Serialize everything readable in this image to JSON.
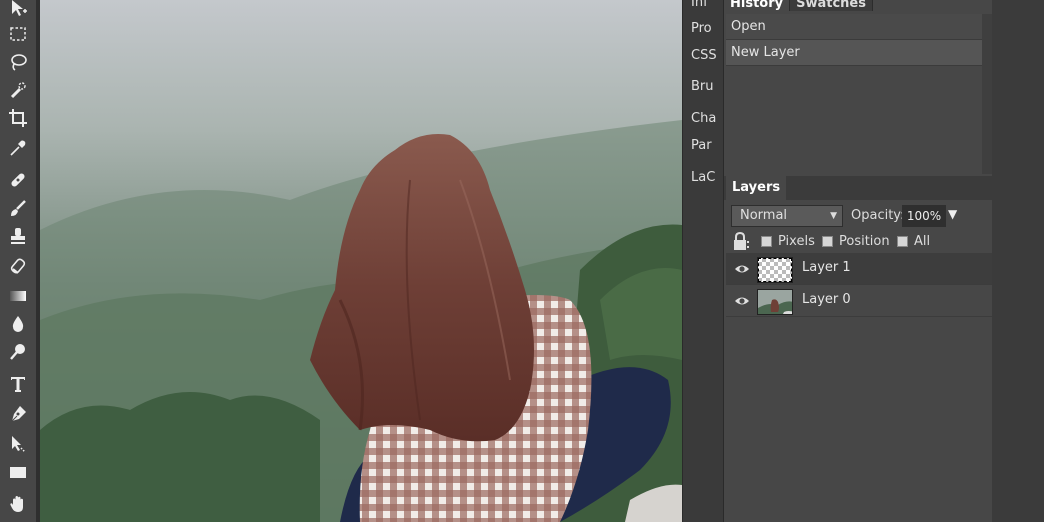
{
  "tools": [
    "move-tool-icon",
    "marquee-tool-icon",
    "lasso-tool-icon",
    "quick-select-tool-icon",
    "crop-tool-icon",
    "eyedropper-tool-icon",
    "healing-tool-icon",
    "brush-tool-icon",
    "clone-stamp-tool-icon",
    "eraser-tool-icon",
    "gradient-tool-icon",
    "blur-tool-icon",
    "dodge-tool-icon",
    "type-tool-icon",
    "pen-tool-icon",
    "path-select-tool-icon",
    "shape-tool-icon",
    "hand-tool-icon"
  ],
  "panel_tabs": [
    "Inf",
    "Pro",
    "CSS",
    "Bru",
    "Cha",
    "Par",
    "LaC"
  ],
  "history": {
    "tabs": [
      "History",
      "Swatches"
    ],
    "items": [
      "Open",
      "New Layer"
    ]
  },
  "layers": {
    "tab": "Layers",
    "blend_mode": "Normal",
    "opacity_label": "Opacity:",
    "opacity_value": "100%",
    "lock_options": [
      "Pixels",
      "Position",
      "All"
    ],
    "items": [
      {
        "name": "Layer 1",
        "selected": true
      },
      {
        "name": "Layer 0",
        "selected": false
      }
    ]
  },
  "colors": {
    "panel_bg": "#474747",
    "toolbar_bg": "#474747",
    "dark_bg": "#383838"
  }
}
